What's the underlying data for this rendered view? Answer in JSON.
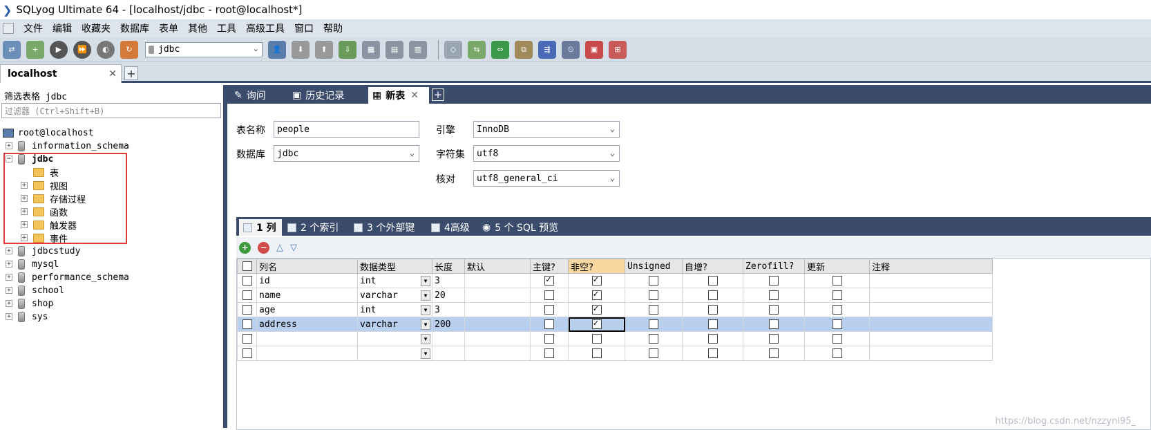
{
  "title_bar": {
    "app_title": "SQLyog Ultimate 64 - [localhost/jdbc - root@localhost*]"
  },
  "menu": [
    "文件",
    "编辑",
    "收藏夹",
    "数据库",
    "表单",
    "其他",
    "工具",
    "高级工具",
    "窗口",
    "帮助"
  ],
  "toolbar": {
    "db_selector_value": "jdbc"
  },
  "connection_tab": {
    "label": "localhost"
  },
  "object_browser": {
    "filter_label": "筛选表格 jdbc",
    "filter_placeholder": "过滤器 (Ctrl+Shift+B)",
    "server": "root@localhost",
    "databases": [
      "information_schema",
      "jdbc",
      "jdbcstudy",
      "mysql",
      "performance_schema",
      "school",
      "shop",
      "sys"
    ],
    "jdbc_children": [
      "表",
      "视图",
      "存储过程",
      "函数",
      "触发器",
      "事件"
    ]
  },
  "query_tabs": [
    "询问",
    "历史记录",
    "新表"
  ],
  "new_table": {
    "table_name_label": "表名称",
    "table_name_value": "people",
    "database_label": "数据库",
    "database_value": "jdbc",
    "engine_label": "引擎",
    "engine_value": "InnoDB",
    "charset_label": "字符集",
    "charset_value": "utf8",
    "collation_label": "核对",
    "collation_value": "utf8_general_ci"
  },
  "sub_tabs": [
    "1 列",
    "2 个索引",
    "3 个外部键",
    "4高级",
    "5 个 SQL 预览"
  ],
  "grid": {
    "headers": [
      "列名",
      "数据类型",
      "长度",
      "默认",
      "主键?",
      "非空?",
      "Unsigned",
      "自增?",
      "Zerofill?",
      "更新",
      "注释"
    ],
    "rows": [
      {
        "name": "id",
        "type": "int",
        "length": "3",
        "pk": true,
        "nn": true
      },
      {
        "name": "name",
        "type": "varchar",
        "length": "20",
        "pk": false,
        "nn": true
      },
      {
        "name": "age",
        "type": "int",
        "length": "3",
        "pk": false,
        "nn": true
      },
      {
        "name": "address",
        "type": "varchar",
        "length": "200",
        "pk": false,
        "nn": true
      },
      {
        "name": "",
        "type": "",
        "length": "",
        "pk": false,
        "nn": false
      },
      {
        "name": "",
        "type": "",
        "length": "",
        "pk": false,
        "nn": false
      }
    ]
  },
  "watermark": "https://blog.csdn.net/nzzynl95_"
}
